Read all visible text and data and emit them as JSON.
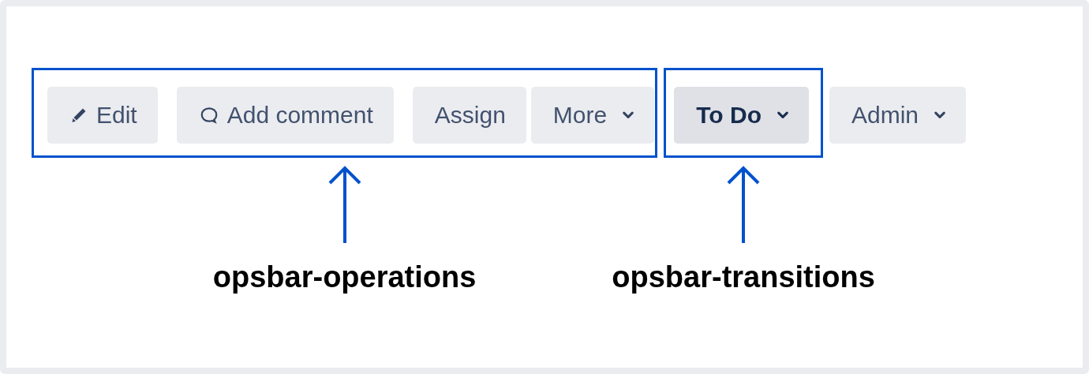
{
  "operations": {
    "label": "opsbar-operations",
    "groups": [
      {
        "buttons": [
          {
            "label": "Edit",
            "kind": "edit"
          }
        ]
      },
      {
        "buttons": [
          {
            "label": "Add comment",
            "kind": "comment"
          }
        ]
      },
      {
        "buttons": [
          {
            "label": "Assign",
            "kind": "plain"
          },
          {
            "label": "More",
            "kind": "menu"
          }
        ]
      }
    ]
  },
  "transitions": {
    "label": "opsbar-transitions",
    "buttons": [
      {
        "label": "To Do"
      }
    ]
  },
  "admin": {
    "label": "Admin"
  }
}
